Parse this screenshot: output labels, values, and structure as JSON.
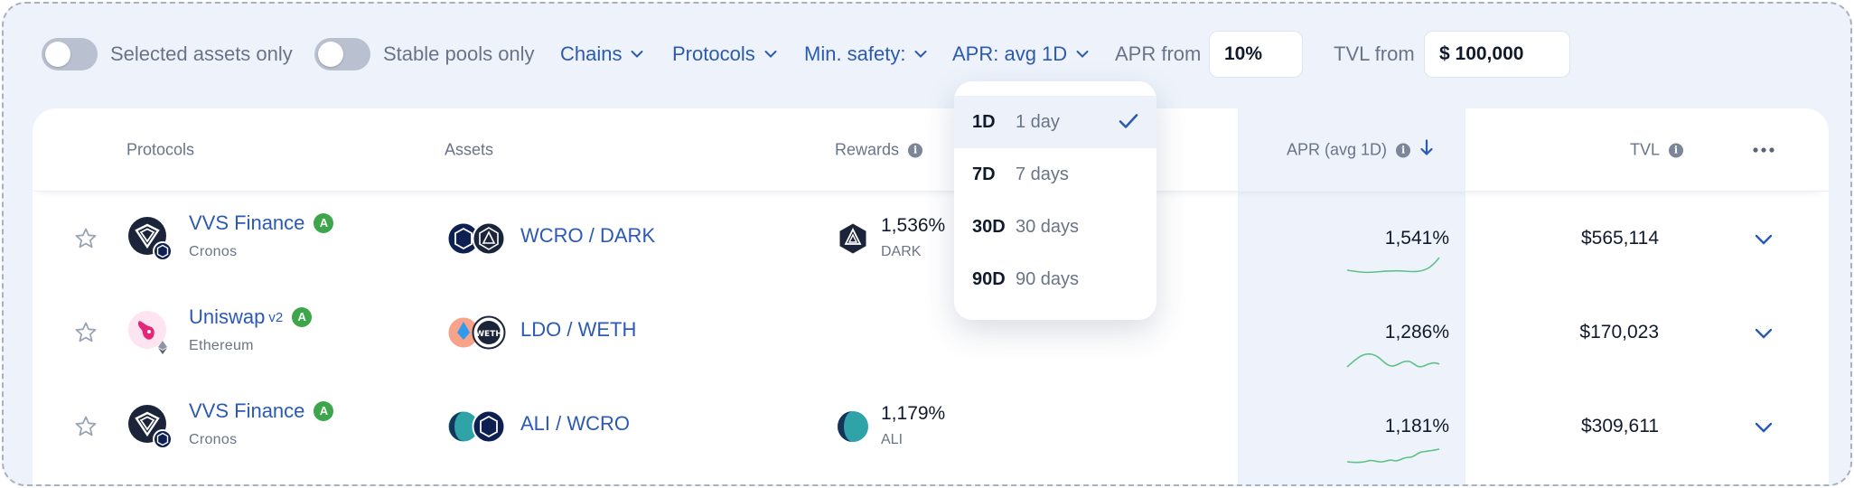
{
  "filters": {
    "selected_assets_label": "Selected assets only",
    "stable_pools_label": "Stable pools only",
    "chains_label": "Chains",
    "protocols_label": "Protocols",
    "min_safety_label": "Min. safety:",
    "apr_label": "APR: avg 1D",
    "apr_from_label": "APR from",
    "apr_from_value": "10%",
    "tvl_from_label": "TVL from",
    "tvl_from_value": "$ 100,000"
  },
  "apr_menu": {
    "items": [
      {
        "code": "1D",
        "label": "1 day",
        "selected": true
      },
      {
        "code": "7D",
        "label": "7 days",
        "selected": false
      },
      {
        "code": "30D",
        "label": "30 days",
        "selected": false
      },
      {
        "code": "90D",
        "label": "90 days",
        "selected": false
      }
    ]
  },
  "table": {
    "headers": {
      "protocols": "Protocols",
      "assets": "Assets",
      "rewards": "Rewards",
      "apr": "APR (avg 1D)",
      "tvl": "TVL"
    },
    "rows": [
      {
        "protocol": "VVS Finance",
        "version": "",
        "safety": "A",
        "chain": "Cronos",
        "assets": "WCRO / DARK",
        "reward_value": "1,536%",
        "reward_token": "DARK",
        "apr": "1,541%",
        "tvl": "$565,114"
      },
      {
        "protocol": "Uniswap",
        "version": "v2",
        "safety": "A",
        "chain": "Ethereum",
        "assets": "LDO / WETH",
        "reward_value": "",
        "reward_token": "",
        "apr": "1,286%",
        "tvl": "$170,023"
      },
      {
        "protocol": "VVS Finance",
        "version": "",
        "safety": "A",
        "chain": "Cronos",
        "assets": "ALI / WCRO",
        "reward_value": "1,179%",
        "reward_token": "ALI",
        "apr": "1,181%",
        "tvl": "$309,611"
      }
    ]
  },
  "icons": {
    "toggle": "toggle-off",
    "dropdown": "chevron-down-icon",
    "info": "info-icon",
    "sort": "arrow-down-icon",
    "more": "ellipsis-icon",
    "favorite": "star-outline-icon",
    "expand": "chevron-down-icon",
    "check": "check-icon"
  },
  "colors": {
    "accent": "#2c5ab0",
    "badge_safety": "#3da64a",
    "sparkline": "#5dc287",
    "panel_bg": "#eef3fb"
  }
}
